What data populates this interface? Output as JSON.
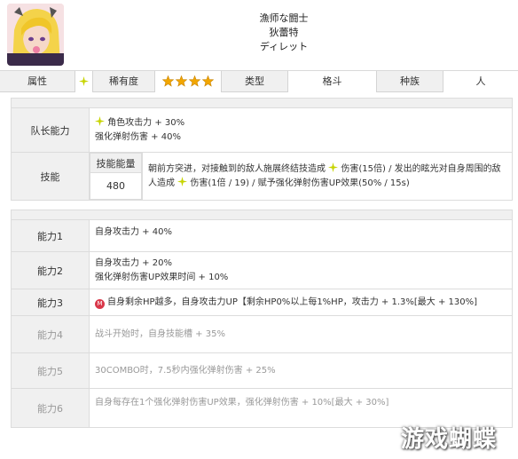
{
  "header": {
    "name_line1": "漁师な闘士",
    "name_line2": "狄蕾特",
    "name_line3": "ディレット"
  },
  "attributes": {
    "attr_label": "属性",
    "rarity_label": "稀有度",
    "rarity_stars": 4,
    "type_label": "类型",
    "type_value": "格斗",
    "race_label": "种族",
    "race_value": "人"
  },
  "leader": {
    "label": "队长能力",
    "line1": "角色攻击力 + 30%",
    "line2": "强化弹射伤害 + 40%"
  },
  "skill": {
    "label": "技能",
    "energy_label": "技能能量",
    "energy_value": "480",
    "desc_part1": "朝前方突进，对接触到的敌人施展终结技造成",
    "desc_part2": "伤害(15倍) / 发出的眩光对自身周围的敌人造成",
    "desc_part3": "伤害(1倍 / 19) / 赋予强化弹射伤害UP效果(50% / 15s)"
  },
  "abilities": [
    {
      "label": "能力1",
      "text": "自身攻击力 + 40%"
    },
    {
      "label": "能力2",
      "text1": "自身攻击力 + 20%",
      "text2": "强化弹射伤害UP效果时间 + 10%"
    },
    {
      "label": "能力3",
      "badge": "M",
      "text": "自身剩余HP越多，自身攻击力UP【剩余HP0%以上每1%HP，攻击力 + 1.3%[最大 + 130%]"
    },
    {
      "label": "能力4",
      "text": "战斗开始时，自身技能槽 + 35%"
    },
    {
      "label": "能力5",
      "text": "30COMBO时，7.5秒内强化弹射伤害 + 25%"
    },
    {
      "label": "能力6",
      "text": "自身每存在1个强化弹射伤害UP效果，强化弹射伤害 + 10%[最大 + 30%]"
    }
  ],
  "watermark": "游戏蝴蝶",
  "colors": {
    "sparkle": "#c7d400",
    "star": "#f2a600",
    "badge": "#d9384a"
  }
}
